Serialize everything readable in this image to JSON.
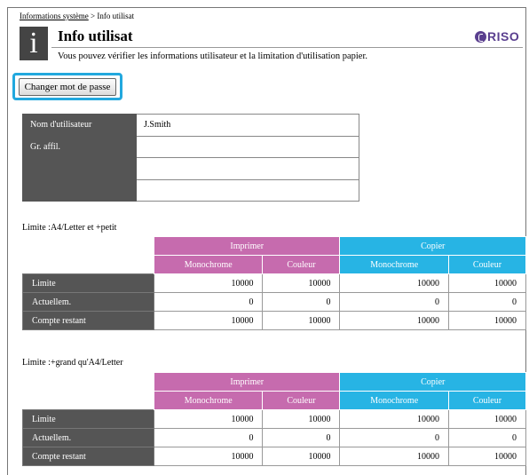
{
  "breadcrumb": {
    "parent": "Informations système",
    "separator": " > ",
    "current": "Info utilisat"
  },
  "header": {
    "icon_glyph": "i",
    "title": "Info utilisat",
    "subtitle": "Vous pouvez vérifier les informations utilisateur et la limitation d'utilisation papier.",
    "logo_text": "RISO",
    "logo_color": "#5a3f8f"
  },
  "actions": {
    "change_password": "Changer mot de passe"
  },
  "user": {
    "name_label": "Nom d'utilisateur",
    "name_value": "J.Smith",
    "group_label": "Gr. affil.",
    "group_values": [
      "",
      "",
      ""
    ]
  },
  "colors": {
    "print_header": "#c66bae",
    "copy_header": "#27b4e4",
    "row_label_bg": "#555555",
    "focus_ring": "#22a8de"
  },
  "limits": [
    {
      "title": "Limite :A4/Letter et +petit",
      "groups": [
        "Imprimer",
        "Copier"
      ],
      "subcolumns": [
        "Monochrome",
        "Couleur",
        "Monochrome",
        "Couleur"
      ],
      "rows": [
        {
          "label": "Limite",
          "values": [
            "10000",
            "10000",
            "10000",
            "10000"
          ]
        },
        {
          "label": "Actuellem.",
          "values": [
            "0",
            "0",
            "0",
            "0"
          ]
        },
        {
          "label": "Compte restant",
          "values": [
            "10000",
            "10000",
            "10000",
            "10000"
          ]
        }
      ]
    },
    {
      "title": "Limite :+grand qu'A4/Letter",
      "groups": [
        "Imprimer",
        "Copier"
      ],
      "subcolumns": [
        "Monochrome",
        "Couleur",
        "Monochrome",
        "Couleur"
      ],
      "rows": [
        {
          "label": "Limite",
          "values": [
            "10000",
            "10000",
            "10000",
            "10000"
          ]
        },
        {
          "label": "Actuellem.",
          "values": [
            "0",
            "0",
            "0",
            "0"
          ]
        },
        {
          "label": "Compte restant",
          "values": [
            "10000",
            "10000",
            "10000",
            "10000"
          ]
        }
      ]
    }
  ]
}
